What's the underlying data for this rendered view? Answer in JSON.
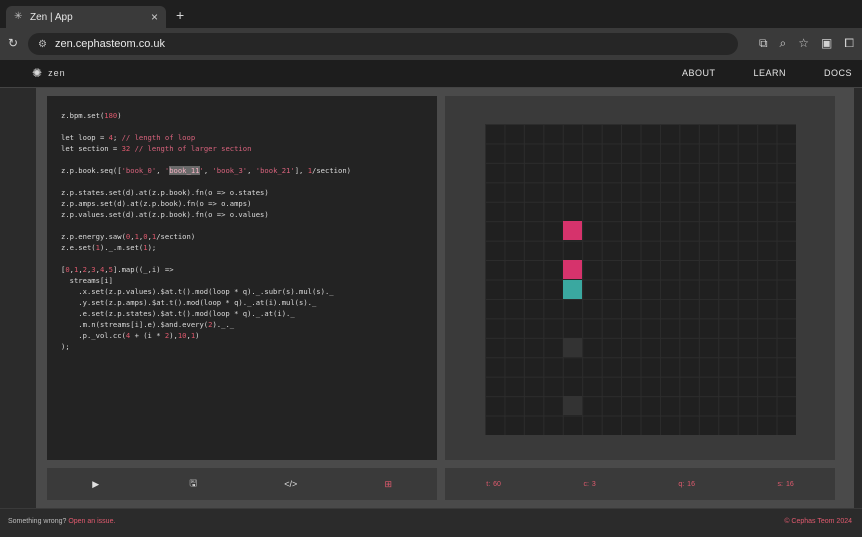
{
  "browser": {
    "tab_title": "Zen | App",
    "url": "zen.cephasteom.co.uk"
  },
  "site": {
    "logo_text": "zen",
    "nav": [
      "ABOUT",
      "LEARN",
      "DOCS"
    ]
  },
  "editor": {
    "lines": [
      "z.bpm.set(180)",
      "",
      "let loop = 4; // length of loop",
      "let section = 32 // length of larger section",
      "",
      "z.p.book.seq(['book_0', 'book_11', 'book_3', 'book_21'], 1/section)",
      "",
      "z.p.states.set(d).at(z.p.book).fn(o => o.states)",
      "z.p.amps.set(d).at(z.p.book).fn(o => o.amps)",
      "z.p.values.set(d).at(z.p.book).fn(o => o.values)",
      "",
      "z.p.energy.saw(0,1,0,1/section)",
      "z.e.set(1)._.m.set(1);",
      "",
      "[0,1,2,3,4,5].map((_,i) =>",
      "  streams[i]",
      "    .x.set(z.p.values).$at.t().mod(loop * q)._.subr(s).mul(s)._",
      "    .y.set(z.p.amps).$at.t().mod(loop * q)._.at(i).mul(s)._",
      "    .e.set(z.p.states).$at.t().mod(loop * q)._.at(i)._",
      "    .m.n(streams[i].e).$and.every(2)._._",
      "    .p._vol.cc(4 + (i * 2),10,1)",
      ");"
    ]
  },
  "visualizer": {
    "colors": {
      "pink": "#d6336c",
      "teal": "#3aa8a0",
      "dark": "#333333"
    },
    "cells": [
      {
        "col": 4,
        "row": 5,
        "color": "pink"
      },
      {
        "col": 4,
        "row": 7,
        "color": "pink"
      },
      {
        "col": 4,
        "row": 8,
        "color": "teal"
      },
      {
        "col": 4,
        "row": 11,
        "color": "dark"
      },
      {
        "col": 4,
        "row": 14,
        "color": "dark"
      }
    ]
  },
  "controls": {
    "play_icon": "play-icon",
    "save_icon": "save-icon",
    "code_icon": "code-icon",
    "grid_icon": "grid-icon"
  },
  "stats": {
    "t_label": "t:",
    "t_value": "60",
    "c_label": "c:",
    "c_value": "3",
    "q_label": "q:",
    "q_value": "16",
    "s_label": "s:",
    "s_value": "16"
  },
  "footer": {
    "prefix": "Something wrong?",
    "link": "Open an issue.",
    "copyright": "© Cephas Teom 2024"
  }
}
